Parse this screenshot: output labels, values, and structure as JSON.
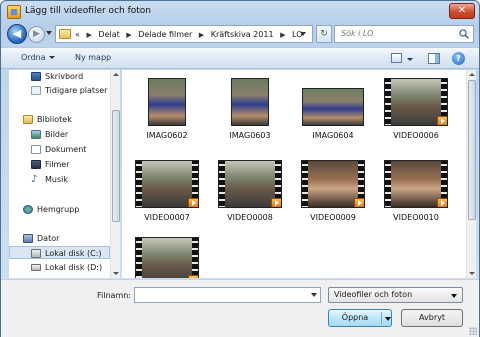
{
  "window": {
    "title": "Lägg till videofiler och foton",
    "close_glyph": "✕"
  },
  "navigation": {
    "back_glyph": "◀",
    "forward_glyph": "▶",
    "breadcrumb_prefix": "«",
    "breadcrumbs": [
      "Delat",
      "Delade filmer",
      "Kräftskiva 2011",
      "LO"
    ],
    "refresh_glyph": "↻",
    "search_placeholder": "Sök i LO"
  },
  "toolbar": {
    "organize": "Ordna",
    "new_folder": "Ny mapp",
    "help_glyph": "?"
  },
  "sidebar": {
    "items": [
      {
        "label": "Skrivbord",
        "icon": "desktop-icon"
      },
      {
        "label": "Tidigare platser",
        "icon": "recent-places-icon"
      },
      {
        "label": "Bibliotek",
        "icon": "libraries-icon"
      },
      {
        "label": "Bilder",
        "icon": "pictures-icon"
      },
      {
        "label": "Dokument",
        "icon": "documents-icon"
      },
      {
        "label": "Filmer",
        "icon": "videos-icon"
      },
      {
        "label": "Musik",
        "icon": "music-icon"
      },
      {
        "label": "Hemgrupp",
        "icon": "homegroup-icon"
      },
      {
        "label": "Dator",
        "icon": "computer-icon"
      },
      {
        "label": "Lokal disk (C:)",
        "icon": "local-disk-c-icon",
        "selected": true
      },
      {
        "label": "Lokal disk (D:)",
        "icon": "local-disk-d-icon"
      }
    ]
  },
  "files": [
    {
      "name": "IMAG0602",
      "kind": "image"
    },
    {
      "name": "IMAG0603",
      "kind": "image"
    },
    {
      "name": "IMAG0604",
      "kind": "image"
    },
    {
      "name": "VIDEO0006",
      "kind": "video"
    },
    {
      "name": "VIDEO0007",
      "kind": "video"
    },
    {
      "name": "VIDEO0008",
      "kind": "video"
    },
    {
      "name": "VIDEO0009",
      "kind": "video"
    },
    {
      "name": "VIDEO0010",
      "kind": "video"
    },
    {
      "name": "",
      "kind": "video"
    }
  ],
  "footer": {
    "filename_label": "Filnamn:",
    "filename_value": "",
    "file_type": "Videofiler och foton",
    "open_button": "Öppna",
    "cancel_button": "Avbryt"
  },
  "colors": {
    "window_frame": "#bfd5ee",
    "selection": "#dbe6f4",
    "open_button": "#bee6fd",
    "video_badge": "#e07a10"
  }
}
